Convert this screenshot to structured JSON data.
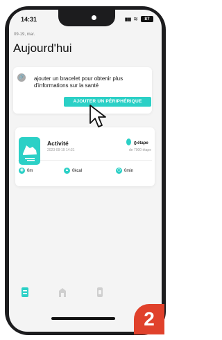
{
  "status_bar": {
    "time": "14:31",
    "battery": "87"
  },
  "header": {
    "date": "09-19, mar.",
    "title": "Aujourd'hui"
  },
  "device_card": {
    "message": "ajouter un bracelet pour obtenir plus d'informations sur la santé",
    "button_label": "AJOUTER UN PÉRIPHÉRIQUE"
  },
  "activity_card": {
    "title": "Activité",
    "datetime": "2023-09-19 14:31",
    "steps_value": "0",
    "steps_label": "étape",
    "steps_goal": "de 7000 étape",
    "distance": "0m",
    "calories": "0kcal",
    "duration": "0min"
  },
  "bottom_nav": {
    "tabs": [
      "today-tab",
      "sport-tab",
      "device-tab",
      "profile-tab"
    ]
  },
  "overlay_badge": "2",
  "colors": {
    "accent": "#2bd0c6",
    "badge": "#e0412b",
    "background": "#f4f4f4"
  }
}
